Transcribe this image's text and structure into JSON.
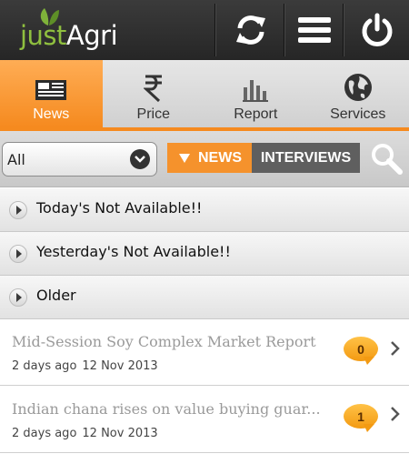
{
  "header": {
    "logo": {
      "part1": "just",
      "part2": "Agri"
    },
    "buttons": [
      {
        "icon": "refresh-icon"
      },
      {
        "icon": "menu-icon"
      },
      {
        "icon": "power-icon"
      }
    ]
  },
  "tabs": [
    {
      "label": "News",
      "icon": "newspaper-icon",
      "active": true
    },
    {
      "label": "Price",
      "icon": "rupee-icon",
      "active": false
    },
    {
      "label": "Report",
      "icon": "bar-chart-icon",
      "active": false
    },
    {
      "label": "Services",
      "icon": "globe-icon",
      "active": false
    }
  ],
  "filter": {
    "select_value": "All",
    "segments": [
      {
        "label": "NEWS",
        "active": true
      },
      {
        "label": "INTERVIEWS",
        "active": false
      }
    ]
  },
  "sections": [
    {
      "label": "Today's Not Available!!"
    },
    {
      "label": "Yesterday's Not Available!!"
    },
    {
      "label": "Older"
    }
  ],
  "articles": [
    {
      "title": "Mid-Session Soy Complex Market Report",
      "age": "2 days ago",
      "date": "12 Nov 2013",
      "comments": "0"
    },
    {
      "title": "Indian chana rises on value buying guar...",
      "age": "2 days ago",
      "date": "12 Nov 2013",
      "comments": "1"
    }
  ],
  "colors": {
    "accent": "#f58a1f",
    "header_bg": "#2f2f2f",
    "logo_green": "#8fbf3f",
    "badge": "#f39a12"
  }
}
